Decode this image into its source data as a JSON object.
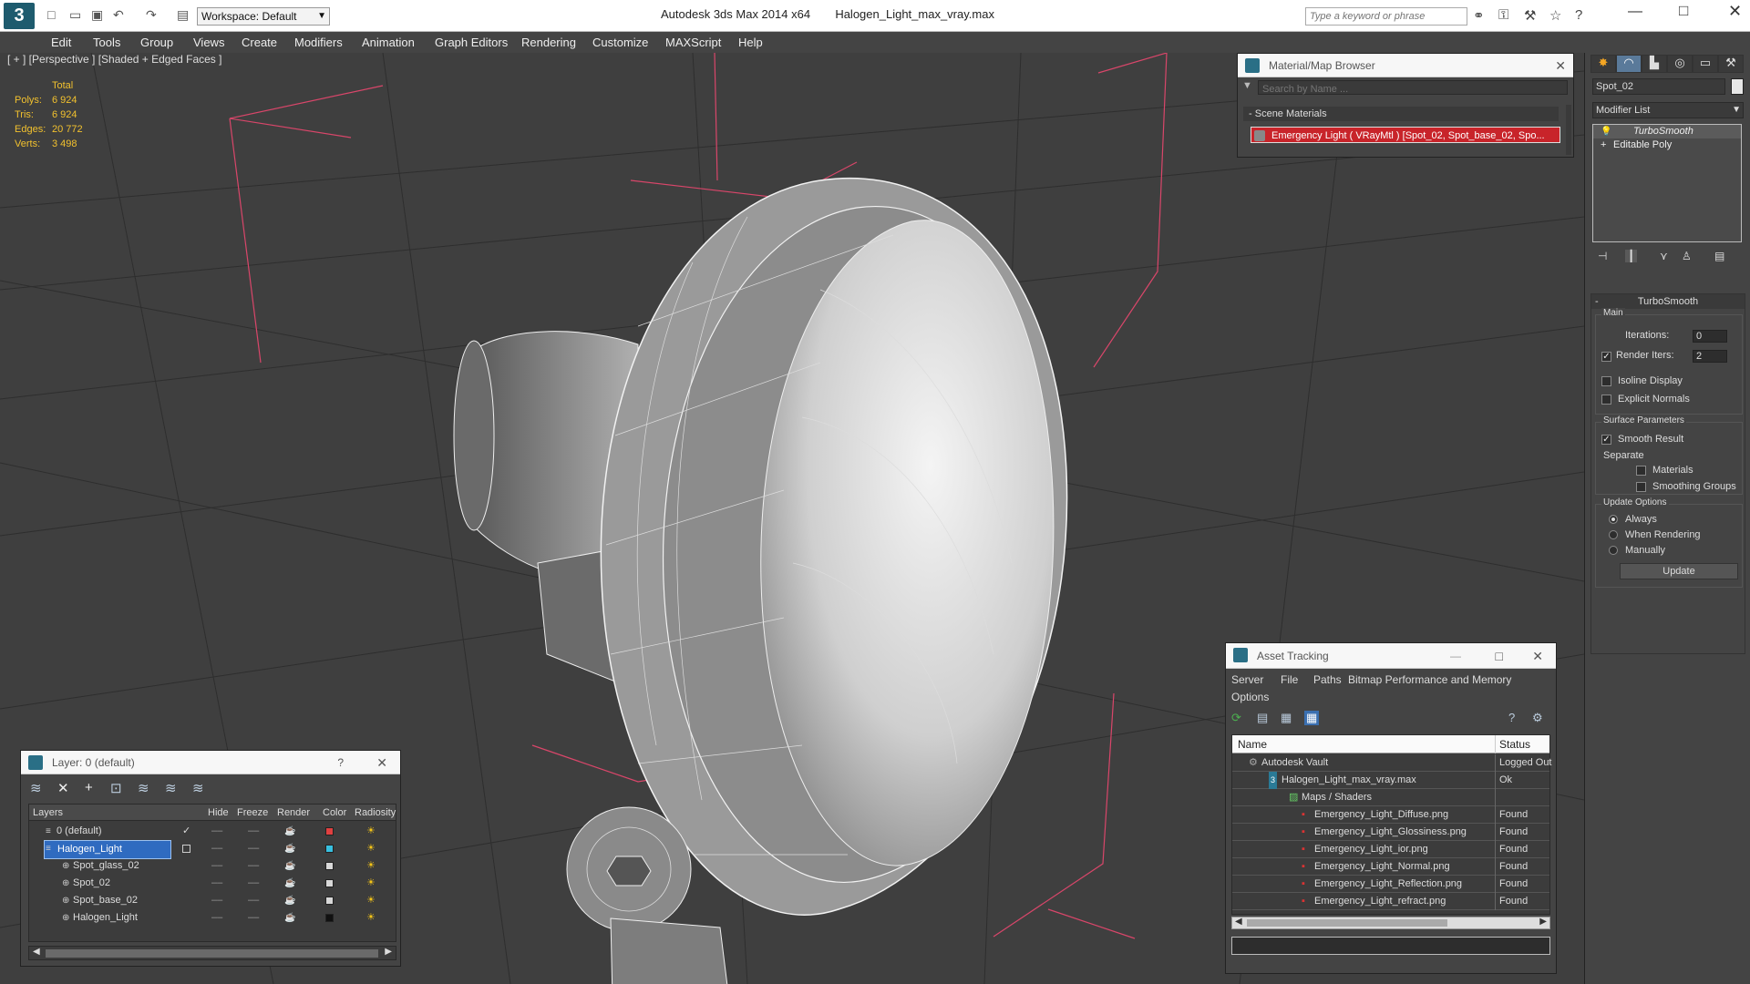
{
  "app": {
    "title": "Autodesk 3ds Max  2014 x64",
    "file": "Halogen_Light_max_vray.max",
    "workspace": "Workspace: Default",
    "search_placeholder": "Type a keyword or phrase"
  },
  "menu": [
    "Edit",
    "Tools",
    "Group",
    "Views",
    "Create",
    "Modifiers",
    "Animation",
    "Graph Editors",
    "Rendering",
    "Customize",
    "MAXScript",
    "Help"
  ],
  "viewport": {
    "label": "[ + ] [Perspective ] [Shaded + Edged Faces ]",
    "stats": {
      "header": "Total",
      "rows": [
        {
          "label": "Polys:",
          "value": "6 924"
        },
        {
          "label": "Tris:",
          "value": "6 924"
        },
        {
          "label": "Edges:",
          "value": "20 772"
        },
        {
          "label": "Verts:",
          "value": "3 498"
        }
      ]
    }
  },
  "material_browser": {
    "title": "Material/Map Browser",
    "search_placeholder": "Search by Name ...",
    "section": "Scene Materials",
    "item": "Emergency Light  ( VRayMtl ) [Spot_02, Spot_base_02, Spo..."
  },
  "command_panel": {
    "object_name": "Spot_02",
    "modifier_list": "Modifier List",
    "stack": [
      "TurboSmooth",
      "Editable Poly"
    ],
    "rollout_title": "TurboSmooth",
    "main_label": "Main",
    "iterations_label": "Iterations:",
    "iterations_value": "0",
    "render_iters_label": "Render Iters:",
    "render_iters_value": "2",
    "isoline": "Isoline Display",
    "explicit_normals": "Explicit Normals",
    "surface_params": "Surface Parameters",
    "smooth_result": "Smooth Result",
    "separate": "Separate",
    "materials": "Materials",
    "smoothing_groups": "Smoothing Groups",
    "update_options": "Update Options",
    "always": "Always",
    "when_rendering": "When Rendering",
    "manually": "Manually",
    "update_button": "Update"
  },
  "layer_manager": {
    "title": "Layer: 0 (default)",
    "help": "?",
    "columns": [
      "Layers",
      "Hide",
      "Freeze",
      "Render",
      "Color",
      "Radiosity"
    ],
    "rows": [
      {
        "name": "0 (default)",
        "color": "#e04040"
      },
      {
        "name": "Halogen_Light",
        "color": "#38c0e0"
      },
      {
        "name": "Spot_glass_02",
        "color": "#d8d8d8"
      },
      {
        "name": "Spot_02",
        "color": "#d8d8d8"
      },
      {
        "name": "Spot_base_02",
        "color": "#d8d8d8"
      },
      {
        "name": "Halogen_Light",
        "color": "#111111"
      }
    ]
  },
  "asset_tracking": {
    "title": "Asset Tracking",
    "menu": [
      "Server",
      "File",
      "Paths",
      "Bitmap Performance and Memory"
    ],
    "menu2": "Options",
    "columns": [
      "Name",
      "Status"
    ],
    "rows": [
      {
        "name": "Autodesk Vault",
        "status": "Logged Out"
      },
      {
        "name": "Halogen_Light_max_vray.max",
        "status": "Ok"
      },
      {
        "name": "Maps / Shaders",
        "status": ""
      },
      {
        "name": "Emergency_Light_Diffuse.png",
        "status": "Found"
      },
      {
        "name": "Emergency_Light_Glossiness.png",
        "status": "Found"
      },
      {
        "name": "Emergency_Light_ior.png",
        "status": "Found"
      },
      {
        "name": "Emergency_Light_Normal.png",
        "status": "Found"
      },
      {
        "name": "Emergency_Light_Reflection.png",
        "status": "Found"
      },
      {
        "name": "Emergency_Light_refract.png",
        "status": "Found"
      }
    ]
  }
}
